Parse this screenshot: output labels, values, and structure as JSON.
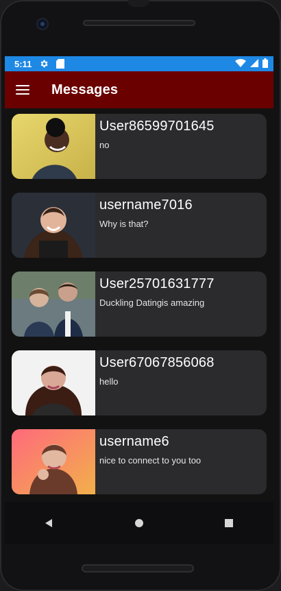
{
  "status": {
    "time": "5:11",
    "icons": [
      "settings-icon",
      "sd-card-icon",
      "wifi-icon",
      "signal-icon",
      "battery-icon"
    ]
  },
  "app_bar": {
    "title": "Messages",
    "menu_icon": "hamburger-menu-icon"
  },
  "messages": [
    {
      "username": "User86599701645",
      "preview": "no"
    },
    {
      "username": "username7016",
      "preview": "Why is that?"
    },
    {
      "username": "User25701631777",
      "preview": "Duckling Datingis amazing"
    },
    {
      "username": "User67067856068",
      "preview": "hello"
    },
    {
      "username": "username6",
      "preview": "nice to connect to you too"
    }
  ],
  "nav": {
    "back_icon": "back-triangle-icon",
    "home_icon": "home-circle-icon",
    "recents_icon": "recents-square-icon"
  },
  "colors": {
    "status_bar": "#1e88e5",
    "app_bar": "#6b0000",
    "card_bg": "#2b2b2d",
    "screen_bg": "#121212"
  }
}
